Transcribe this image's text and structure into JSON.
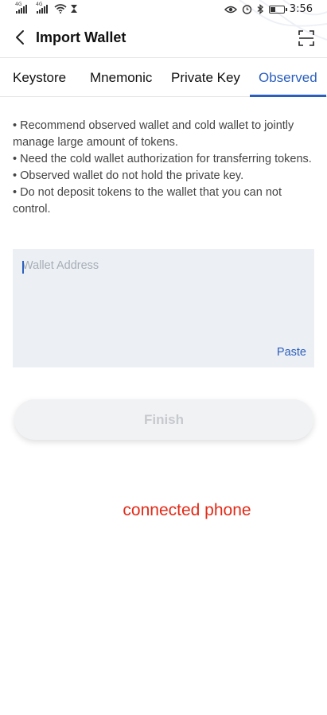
{
  "status_bar": {
    "network_labels": [
      "4G",
      "4G"
    ],
    "time": "3:56",
    "battery_percent": 35,
    "icons": [
      "signal-icon",
      "signal-icon",
      "wifi-icon",
      "hourglass-icon",
      "eye-icon",
      "alarm-icon",
      "bluetooth-icon",
      "battery-icon"
    ]
  },
  "header": {
    "title": "Import Wallet",
    "back_icon": "back-arrow-icon",
    "scan_icon": "scan-icon"
  },
  "tabs": [
    {
      "label": "Keystore",
      "active": false
    },
    {
      "label": "Mnemonic",
      "active": false
    },
    {
      "label": "Private Key",
      "active": false
    },
    {
      "label": "Observed",
      "active": true
    }
  ],
  "tips": [
    "• Recommend observed wallet and cold wallet to jointly manage large amount of tokens.",
    "• Need the cold wallet authorization for transferring tokens.",
    "• Observed wallet do not hold the private key.",
    "• Do not deposit tokens to the wallet that you can not control."
  ],
  "address_input": {
    "placeholder": "Wallet Address",
    "value": "",
    "paste_label": "Paste"
  },
  "finish_button": {
    "label": "Finish",
    "enabled": false
  },
  "annotation": "connected phone",
  "colors": {
    "accent": "#2b5fbf",
    "input_bg": "#eceff3",
    "annotation": "#e32a17",
    "disabled_text": "#c6c9ce"
  }
}
